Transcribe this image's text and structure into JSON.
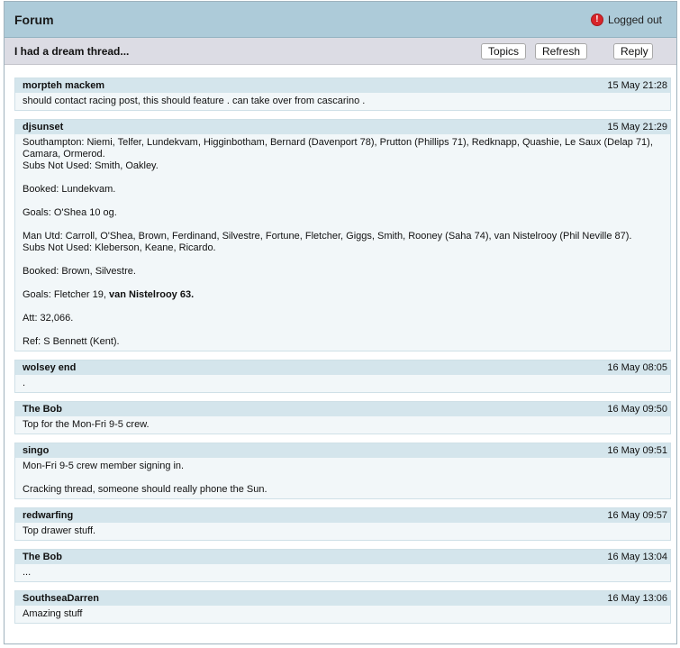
{
  "header": {
    "title": "Forum",
    "status": "Logged out",
    "status_icon": "alert-icon"
  },
  "toolbar": {
    "thread_title": "I had a dream thread...",
    "topics": "Topics",
    "refresh": "Refresh",
    "reply": "Reply"
  },
  "posts": [
    {
      "author": "morpteh mackem",
      "time": "15 May 21:28",
      "lines": [
        "should contact racing post, this should feature . can take over from cascarino ."
      ]
    },
    {
      "author": "djsunset",
      "time": "15 May 21:29",
      "lines": [
        "Southampton: Niemi, Telfer, Lundekvam, Higginbotham, Bernard (Davenport 78), Prutton (Phillips 71), Redknapp, Quashie, Le Saux (Delap 71), Camara, Ormerod.",
        "Subs Not Used: Smith, Oakley.",
        "Booked: Lundekvam.",
        "Goals: O'Shea 10 og.",
        "Man Utd: Carroll, O'Shea, Brown, Ferdinand, Silvestre, Fortune, Fletcher, Giggs, Smith, Rooney (Saha 74), van Nistelrooy (Phil Neville 87).",
        "Subs Not Used: Kleberson, Keane, Ricardo.",
        "Booked: Brown, Silvestre.",
        "Goals: Fletcher 19, ",
        "van Nistelrooy 63.",
        "Att: 32,066.",
        "Ref: S Bennett (Kent)."
      ]
    },
    {
      "author": "wolsey end",
      "time": "16 May 08:05",
      "lines": [
        "."
      ]
    },
    {
      "author": "The Bob",
      "time": "16 May 09:50",
      "lines": [
        "Top for the Mon-Fri 9-5 crew."
      ]
    },
    {
      "author": "singo",
      "time": "16 May 09:51",
      "lines": [
        "Mon-Fri 9-5 crew member signing in.",
        "Cracking thread, someone should really phone the Sun."
      ]
    },
    {
      "author": "redwarfing",
      "time": "16 May 09:57",
      "lines": [
        "Top drawer stuff."
      ]
    },
    {
      "author": "The Bob",
      "time": "16 May 13:04",
      "lines": [
        "..."
      ]
    },
    {
      "author": "SouthseaDarren",
      "time": "16 May 13:06",
      "lines": [
        "Amazing stuff"
      ]
    }
  ],
  "colors": {
    "header_bg": "#adcbd9",
    "post_head_bg": "#d4e5ec",
    "post_body_bg": "#f2f7f9",
    "alert": "#d8242a"
  }
}
